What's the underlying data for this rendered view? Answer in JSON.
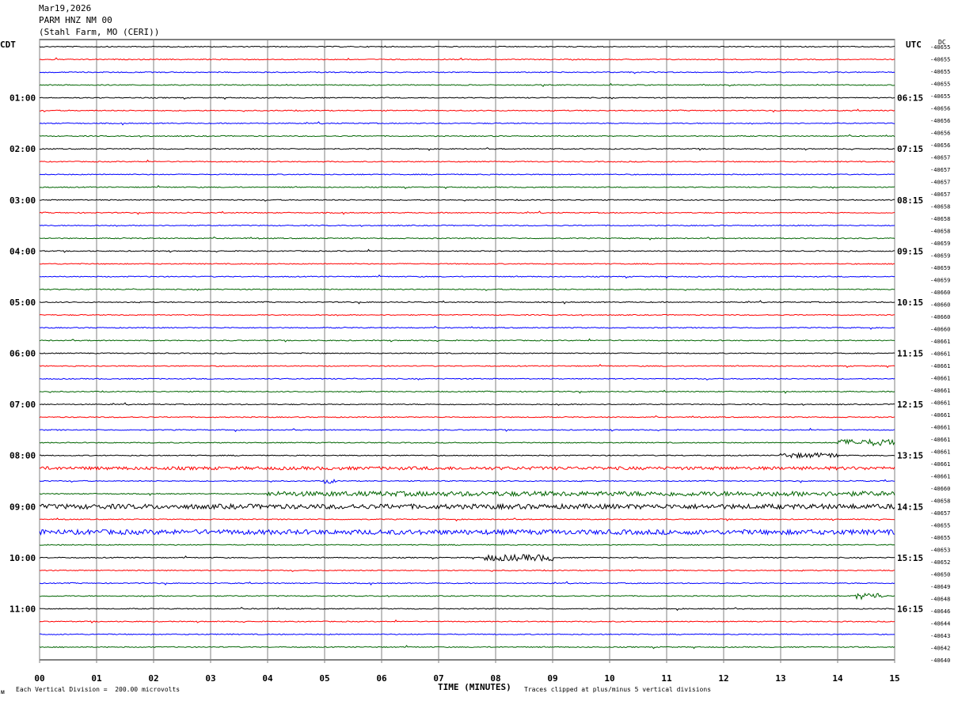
{
  "header": {
    "date": "Mar19,2026",
    "station": "PARM HNZ NM 00",
    "site": "(Stahl Farm, MO (CERI))"
  },
  "left_tz": "CDT",
  "right_tz": "UTC",
  "dc_label": "DC",
  "footer": {
    "scale": "Each Vertical Division =  200.00 microvolts",
    "xlabel": "TIME (MINUTES)",
    "clip_note": "Traces clipped at plus/minus 5 vertical divisions",
    "mark": "ᴍ"
  },
  "colors": {
    "trace_cycle": [
      "#000000",
      "#ff0000",
      "#0000ff",
      "#006400"
    ],
    "grid": "#808080"
  },
  "chart_data": {
    "type": "line",
    "title": "PARM HNZ NM 00",
    "xlabel": "TIME (MINUTES)",
    "xlim": [
      0,
      15
    ],
    "x_ticks": [
      "00",
      "01",
      "02",
      "03",
      "04",
      "05",
      "06",
      "07",
      "08",
      "09",
      "10",
      "11",
      "12",
      "13",
      "14",
      "15"
    ],
    "trace_count": 48,
    "left_hour_labels": [
      "01:00",
      "02:00",
      "03:00",
      "04:00",
      "05:00",
      "06:00",
      "07:00",
      "08:00",
      "09:00",
      "10:00",
      "11:00"
    ],
    "right_hour_labels": [
      "06:15",
      "07:15",
      "08:15",
      "09:15",
      "10:15",
      "11:15",
      "12:15",
      "13:15",
      "14:15",
      "15:15",
      "16:15"
    ],
    "dc_offsets": [
      "-40655",
      "-40655",
      "-40655",
      "-40655",
      "-40655",
      "-40656",
      "-40656",
      "-40656",
      "-40656",
      "-40657",
      "-40657",
      "-40657",
      "-40657",
      "-40658",
      "-40658",
      "-40658",
      "-40659",
      "-40659",
      "-40659",
      "-40659",
      "-40660",
      "-40660",
      "-40660",
      "-40660",
      "-40661",
      "-40661",
      "-40661",
      "-40661",
      "-40661",
      "-40661",
      "-40661",
      "-40661",
      "-40661",
      "-40661",
      "-40661",
      "-40661",
      "-40660",
      "-40658",
      "-40657",
      "-40655",
      "-40655",
      "-40653",
      "-40652",
      "-40650",
      "-40649",
      "-40648",
      "-40646",
      "-40644",
      "-40643",
      "-40642",
      "-40640"
    ],
    "trace_activity": [
      {
        "trace": 34,
        "from_min": 5.0,
        "to_min": 5.2,
        "amp": 3
      },
      {
        "trace": 32,
        "from_min": 13.0,
        "to_min": 14.0,
        "amp": 3
      },
      {
        "trace": 31,
        "from_min": 14.0,
        "to_min": 15.0,
        "amp": 4
      },
      {
        "trace": 33,
        "from_min": 0.0,
        "to_min": 15.0,
        "amp": 2
      },
      {
        "trace": 35,
        "from_min": 4.0,
        "to_min": 15.0,
        "amp": 3
      },
      {
        "trace": 36,
        "from_min": 0.0,
        "to_min": 15.0,
        "amp": 3
      },
      {
        "trace": 38,
        "from_min": 0.0,
        "to_min": 15.0,
        "amp": 3
      },
      {
        "trace": 40,
        "from_min": 7.8,
        "to_min": 9.0,
        "amp": 4
      },
      {
        "trace": 43,
        "from_min": 14.3,
        "to_min": 14.8,
        "amp": 4
      }
    ]
  }
}
